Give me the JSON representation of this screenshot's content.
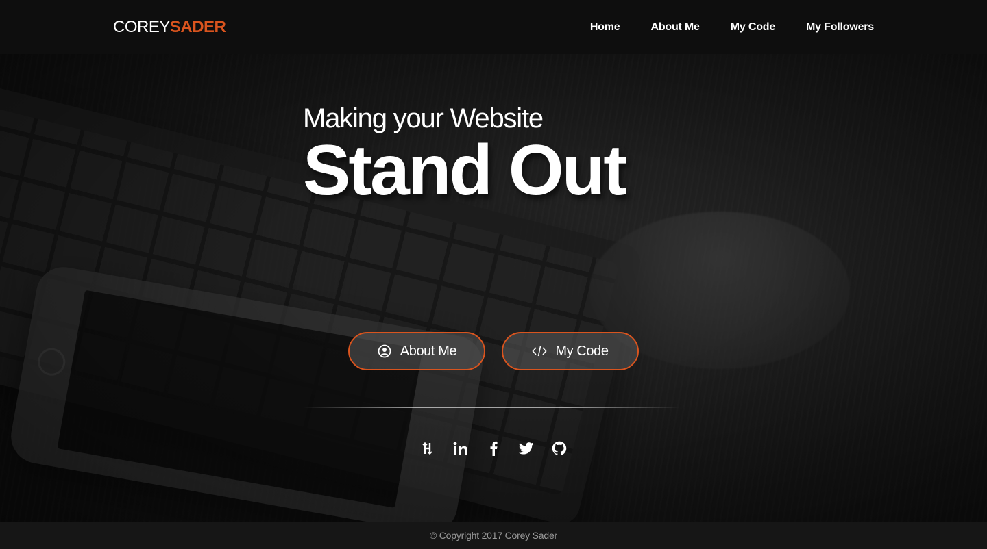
{
  "brand": {
    "first": "COREY",
    "last": "SADER",
    "accent": "#d9541e"
  },
  "nav": {
    "items": [
      {
        "label": "Home"
      },
      {
        "label": "About Me"
      },
      {
        "label": "My Code"
      },
      {
        "label": "My Followers"
      }
    ]
  },
  "hero": {
    "tagline": "Making your Website",
    "headline": "Stand Out",
    "buttons": [
      {
        "label": "About Me",
        "icon": "user-circle-icon"
      },
      {
        "label": "My Code",
        "icon": "code-icon"
      }
    ],
    "social": [
      "hackerrank-icon",
      "linkedin-icon",
      "facebook-icon",
      "twitter-icon",
      "github-icon"
    ]
  },
  "footer": {
    "copyright": "© Copyright 2017 Corey Sader"
  }
}
